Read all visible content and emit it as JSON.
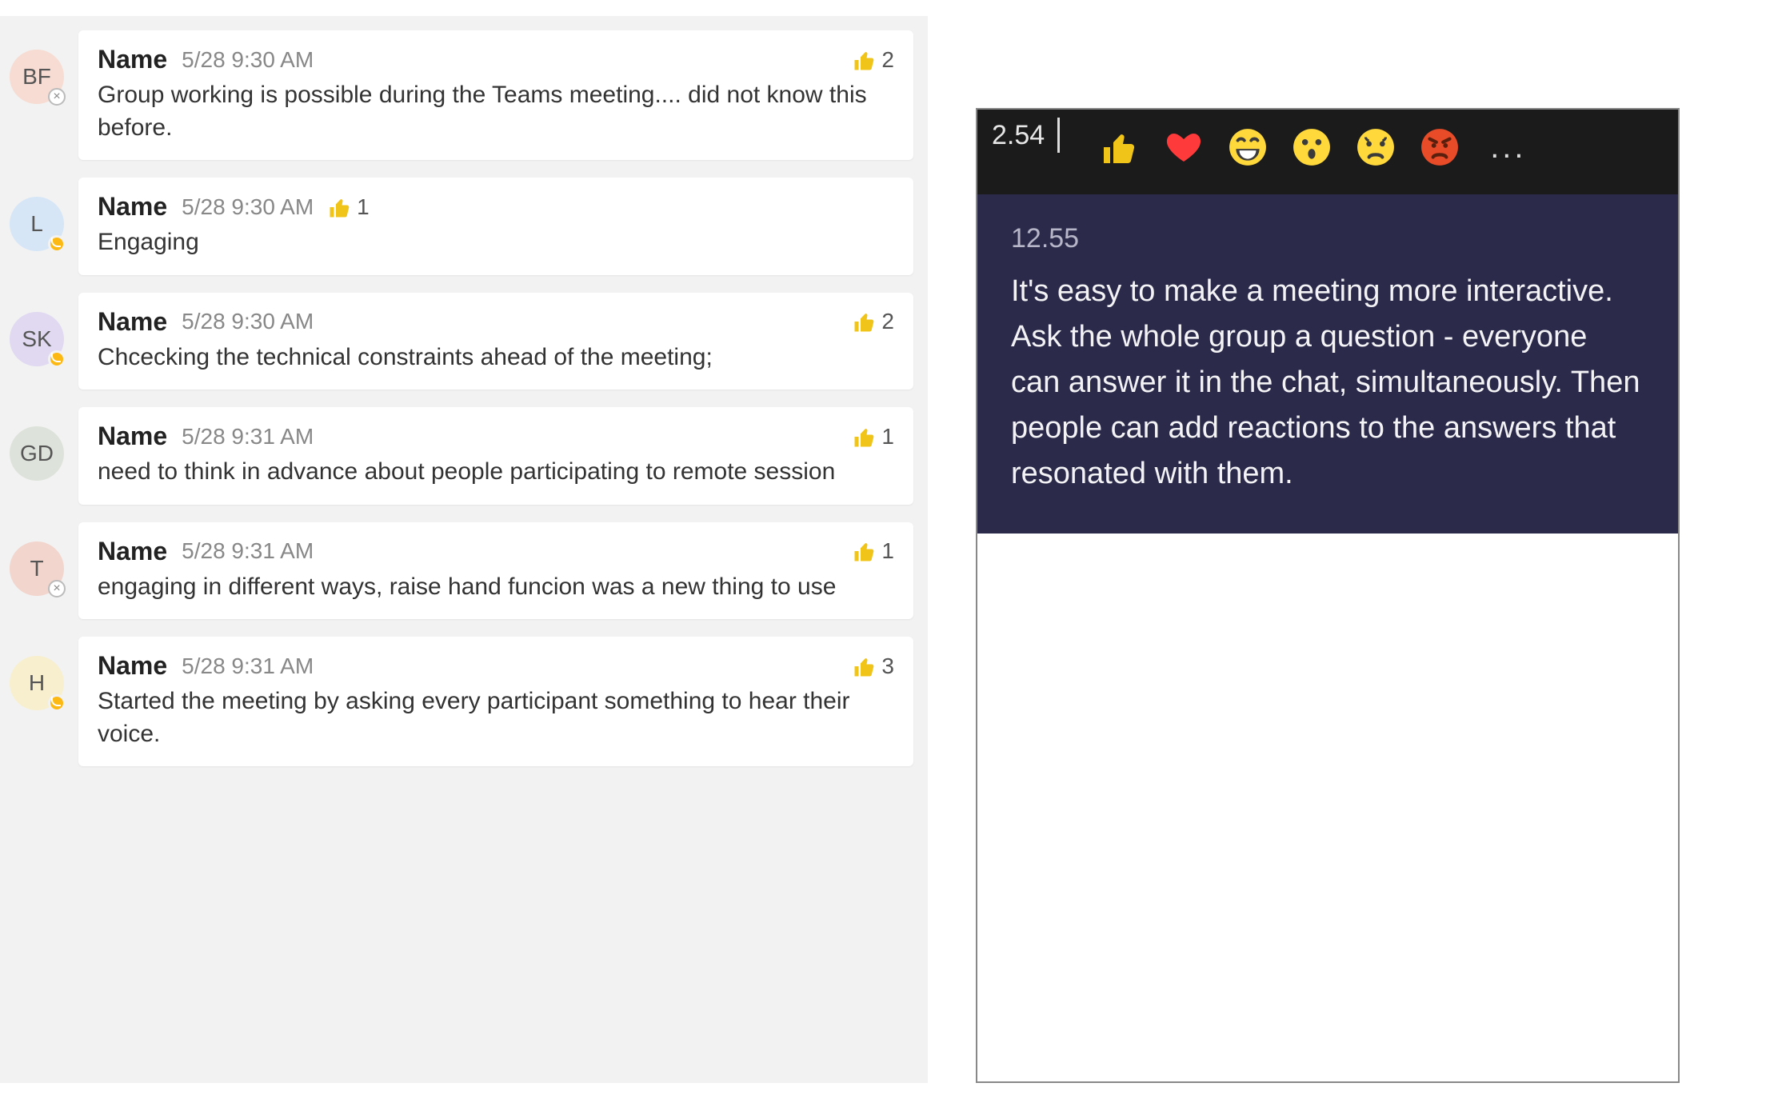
{
  "left": {
    "messages": [
      {
        "initials": "BF",
        "avatar_bg": "#f6dcd2",
        "presence": "offline",
        "name": "Name",
        "time": "5/28 9:30 AM",
        "react_placement": "right",
        "react_count": "2",
        "body": "Group working is possible during the Teams meeting.... did not know this before."
      },
      {
        "initials": "L",
        "avatar_bg": "#d6e6f7",
        "presence": "away",
        "name": "Name",
        "time": "5/28 9:30 AM",
        "react_placement": "inline",
        "react_count": "1",
        "body": "Engaging"
      },
      {
        "initials": "SK",
        "avatar_bg": "#e0d9f1",
        "presence": "away",
        "name": "Name",
        "time": "5/28 9:30 AM",
        "react_placement": "right",
        "react_count": "2",
        "body": "Chcecking the technical constraints ahead of the meeting;"
      },
      {
        "initials": "GD",
        "avatar_bg": "#dde3da",
        "presence": "none",
        "name": "Name",
        "time": "5/28 9:31 AM",
        "react_placement": "right",
        "react_count": "1",
        "body": "need to think in advance about people participating to remote session"
      },
      {
        "initials": "T",
        "avatar_bg": "#f2d5cc",
        "presence": "offline",
        "name": "Name",
        "time": "5/28 9:31 AM",
        "react_placement": "right",
        "react_count": "1",
        "body": "engaging in different ways, raise hand funcion was a new thing to use"
      },
      {
        "initials": "H",
        "avatar_bg": "#f7efce",
        "presence": "away",
        "name": "Name",
        "time": "5/28 9:31 AM",
        "react_placement": "right",
        "react_count": "3",
        "body": "Started the meeting by asking every participant something to hear their voice."
      }
    ]
  },
  "right": {
    "bar_left_text": "2.54",
    "reactions": [
      "like",
      "heart",
      "laugh",
      "surprised",
      "sad",
      "angry"
    ],
    "more_label": "...",
    "body_time": "12.55",
    "body_text": "It's easy to make a meeting more interactive. Ask the whole group a question - everyone can answer it in the chat, simultaneously. Then people can add reactions to the answers that resonated with them."
  }
}
